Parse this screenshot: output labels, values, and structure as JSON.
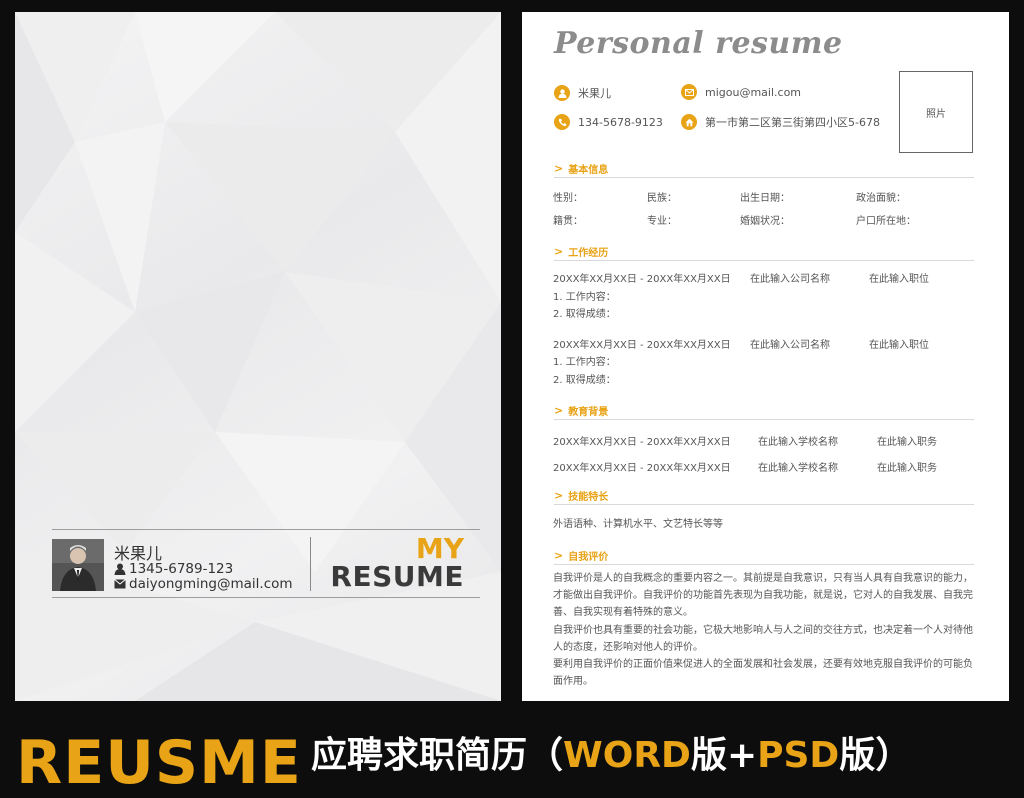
{
  "cover": {
    "name": "米果儿",
    "phone": "1345-6789-123",
    "email": "daiyongming@mail.com",
    "my": "MY",
    "resume": "RESUME"
  },
  "resume": {
    "title": "Personal resume",
    "contacts": {
      "name": "米果儿",
      "email": "migou@mail.com",
      "phone": "134-5678-9123",
      "address": "第一市第二区第三街第四小区5-678"
    },
    "photo_label": "照片",
    "sections": {
      "basic": "基本信息",
      "work": "工作经历",
      "edu": "教育背景",
      "skills": "技能特长",
      "self": "自我评价"
    },
    "basic_fields": [
      "性别：",
      "民族：",
      "出生日期：",
      "政治面貌：",
      "籍贯：",
      "专业：",
      "婚姻状况：",
      "户口所在地："
    ],
    "work": [
      {
        "date": "20XX年XX月XX日 - 20XX年XX月XX日",
        "company": "在此输入公司名称",
        "position": "在此输入职位",
        "line1": "1. 工作内容：",
        "line2": "2. 取得成绩："
      },
      {
        "date": "20XX年XX月XX日 - 20XX年XX月XX日",
        "company": "在此输入公司名称",
        "position": "在此输入职位",
        "line1": "1. 工作内容：",
        "line2": "2. 取得成绩："
      }
    ],
    "edu": [
      {
        "date": "20XX年XX月XX日 - 20XX年XX月XX日",
        "school": "在此输入学校名称",
        "role": "在此输入职务"
      },
      {
        "date": "20XX年XX月XX日 - 20XX年XX月XX日",
        "school": "在此输入学校名称",
        "role": "在此输入职务"
      }
    ],
    "skills_text": "外语语种、计算机水平、文艺特长等等",
    "self_eval": [
      "自我评价是人的自我概念的重要内容之一。其前提是自我意识，只有当人具有自我意识的能力，",
      "才能做出自我评价。自我评价的功能首先表现为自我功能，就是说，它对人的自我发展、自我完",
      "善、自我实现有着特殊的意义。",
      "自我评价也具有重要的社会功能，它极大地影响人与人之间的交往方式，也决定着一个人对待他",
      "人的态度，还影响对他人的评价。",
      "要利用自我评价的正面价值来促进人的全面发展和社会发展，还要有效地克服自我评价的可能负",
      "面作用。"
    ]
  },
  "banner": {
    "left": "REUSME",
    "right_prefix": "应聘求职简历（",
    "right_word": "WORD",
    "right_ban1": "版+",
    "right_psd": "PSD",
    "right_ban2": "版）"
  },
  "colors": {
    "accent": "#e8a316",
    "background": "#0d0d0d"
  }
}
